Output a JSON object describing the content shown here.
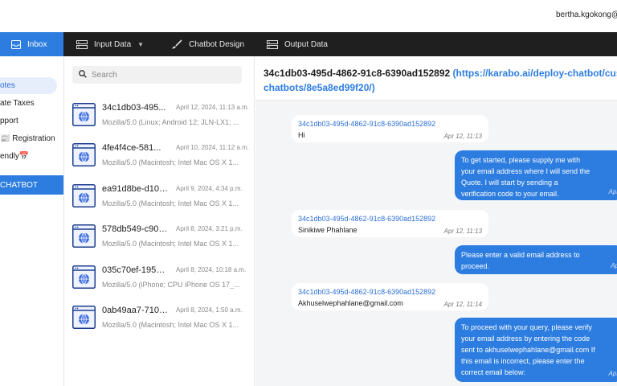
{
  "header": {
    "user_email": "bertha.kgokong@t"
  },
  "nav": {
    "inbox": "Inbox",
    "input_data": "Input Data",
    "chatbot_design": "Chatbot Design",
    "output_data": "Output Data"
  },
  "sidebar": {
    "items": [
      {
        "label": "otes"
      },
      {
        "label": "ate Taxes"
      },
      {
        "label": "pport"
      },
      {
        "label": "📰 Registration"
      },
      {
        "label": "endly📅"
      }
    ],
    "chatbot_label": "CHATBOT"
  },
  "search": {
    "placeholder": "Search"
  },
  "conversations": [
    {
      "id": "34c1db03-495...",
      "date": "April 12, 2024, 11:13 a.m.",
      "ua": "Mozilla/5.0 (Linux; Android 12; JLN-LX1; ..."
    },
    {
      "id": "4fe4f4ce-581...",
      "date": "April 10, 2024, 11:12 a.m.",
      "ua": "Mozilla/5.0 (Macintosh; Intel Mac OS X 1..."
    },
    {
      "id": "ea91d8be-d102-...",
      "date": "April 9, 2024, 4:34 p.m.",
      "ua": "Mozilla/5.0 (Macintosh; Intel Mac OS X 1..."
    },
    {
      "id": "578db549-c902...",
      "date": "April 8, 2024, 3:21 p.m.",
      "ua": "Mozilla/5.0 (Macintosh; Intel Mac OS X 1..."
    },
    {
      "id": "035c70ef-1953...",
      "date": "April 8, 2024, 10:18 a.m.",
      "ua": "Mozilla/5.0 (iPhone; CPU iPhone OS 17_..."
    },
    {
      "id": "0ab49aa7-7100-...",
      "date": "April 8, 2024, 1:50 a.m.",
      "ua": "Mozilla/5.0 (Macintosh; Intel Mac OS X 1..."
    }
  ],
  "chat": {
    "title_id": "34c1db03-495d-4862-91c8-6390ad152892",
    "title_link_line1": "(https://karabo.ai/deploy-chatbot/custon",
    "title_link_line2": "chatbots/8e5a8ed99f20/)",
    "messages": [
      {
        "sender": "34c1db03-495d-4862-91c8-6390ad152892",
        "text": "Hi",
        "time": "Apr 12, 11:13"
      },
      {
        "lines": [
          "To get started, please supply me with",
          "your email address where I will send the",
          "Quote. I will start by sending a",
          "verification code to your email."
        ],
        "time": "Apr"
      },
      {
        "sender": "34c1db03-495d-4862-91c8-6390ad152892",
        "text": "Sinikiwe Phahlane",
        "time": "Apr 12, 11:13"
      },
      {
        "lines": [
          "Please enter a valid email address to",
          "proceed."
        ],
        "time": "Ap"
      },
      {
        "sender": "34c1db03-495d-4862-91c8-6390ad152892",
        "text": "Akhuselwephahlane@gmail.com",
        "time": "Apr 12, 11:14"
      },
      {
        "lines": [
          "To proceed with your query, please verify",
          "your email address by entering the code",
          "sent to akhuselwephahlane@gmail.com If",
          "this email is incorrect, please enter the",
          "correct email below:"
        ],
        "time": "Apr"
      }
    ]
  }
}
